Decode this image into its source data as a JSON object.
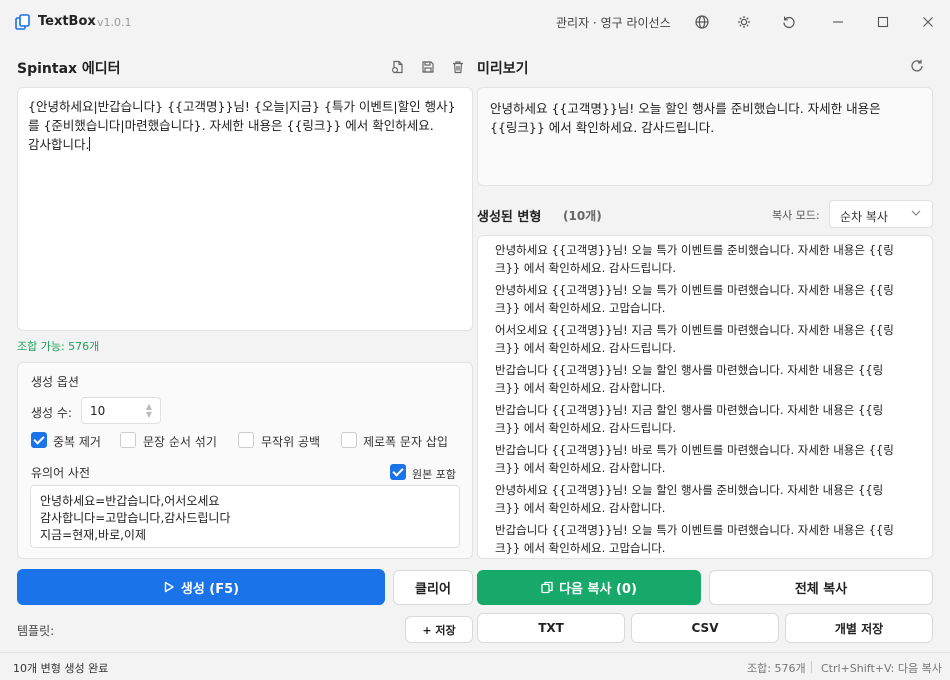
{
  "titlebar": {
    "app_name": "TextBox",
    "version": "v1.0.1",
    "license": "관리자 · 영구 라이선스"
  },
  "editor": {
    "title": "Spintax 에디터",
    "lines": [
      "{안녕하세요|반갑습니다} {{고객명}}님! {오늘|지금} {특가 이벤트|할인 행사}",
      "를 {준비했습니다|마련했습니다}. 자세한 내용은 {{링크}} 에서 확인하세요.",
      "감사합니다."
    ],
    "combinations": "조합 가능: 576개"
  },
  "options": {
    "title": "생성 옵션",
    "count_label": "생성 수:",
    "count_value": "10",
    "dedupe": "중복 제거",
    "shuffle": "문장 순서 섞기",
    "random_space": "무작위 공백",
    "zero_width": "제로폭 문자 삽입",
    "synonym_title": "유의어 사전",
    "include_original": "원본 포함",
    "synonyms": [
      "안녕하세요=반갑습니다,어서오세요",
      "감사합니다=고맙습니다,감사드립니다",
      "지금=현재,바로,이제"
    ]
  },
  "preview": {
    "title": "미리보기",
    "lines": [
      "안녕하세요 {{고객명}}님! 오늘 할인 행사를 준비했습니다. 자세한 내용은",
      "{{링크}} 에서 확인하세요. 감사드립니다."
    ]
  },
  "variants": {
    "title": "생성된 변형",
    "count": "(10개)",
    "copy_mode_label": "복사 모드:",
    "copy_mode_value": "순차 복사",
    "items": [
      [
        "안녕하세요 {{고객명}}님! 오늘 특가 이벤트를 준비했습니다. 자세한 내용은 {{링",
        "크}} 에서 확인하세요. 감사드립니다."
      ],
      [
        "안녕하세요 {{고객명}}님! 오늘 특가 이벤트를 마련했습니다. 자세한 내용은 {{링",
        "크}} 에서 확인하세요. 고맙습니다."
      ],
      [
        "어서오세요 {{고객명}}님! 지금 특가 이벤트를 마련했습니다. 자세한 내용은 {{링",
        "크}} 에서 확인하세요. 감사드립니다."
      ],
      [
        "반갑습니다 {{고객명}}님! 오늘 할인 행사를 마련했습니다. 자세한 내용은 {{링",
        "크}} 에서 확인하세요. 감사합니다."
      ],
      [
        "반갑습니다 {{고객명}}님! 지금 할인 행사를 마련했습니다. 자세한 내용은 {{링",
        "크}} 에서 확인하세요. 감사드립니다."
      ],
      [
        "반갑습니다 {{고객명}}님! 바로 특가 이벤트를 마련했습니다. 자세한 내용은 {{링",
        "크}} 에서 확인하세요. 감사합니다."
      ],
      [
        "안녕하세요 {{고객명}}님! 오늘 할인 행사를 준비했습니다. 자세한 내용은 {{링",
        "크}} 에서 확인하세요. 감사합니다."
      ],
      [
        "반갑습니다 {{고객명}}님! 오늘 특가 이벤트를 마련했습니다. 자세한 내용은 {{링",
        "크}} 에서 확인하세요. 고맙습니다."
      ]
    ]
  },
  "buttons": {
    "generate": "생성 (F5)",
    "clear": "클리어",
    "copy_next": "다음 복사 (0)",
    "copy_all": "전체 복사",
    "template_label": "템플릿:",
    "save_template": "+ 저장",
    "txt": "TXT",
    "csv": "CSV",
    "save_each": "개별 저장"
  },
  "status": {
    "message": "10개 변형 생성 완료",
    "combinations": "조합: 576개",
    "shortcut": "Ctrl+Shift+V: 다음 복사"
  },
  "colors": {
    "accent": "#1a73e8",
    "success": "#17a96a",
    "combo_text": "#1aa35a"
  }
}
